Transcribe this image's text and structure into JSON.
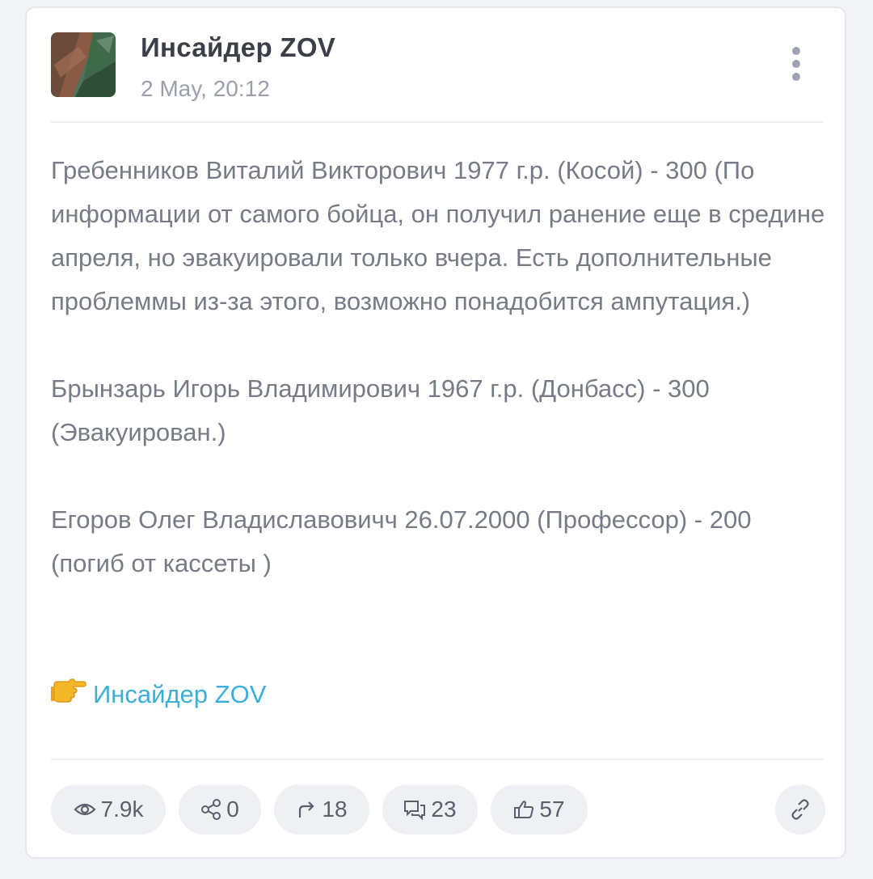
{
  "post": {
    "channel_name": "Инсайдер ZOV",
    "time": "2 May, 20:12",
    "paragraphs": [
      "Гребенников Виталий Викторович 1977 г.р. (Косой) - 300 (По информации от самого бойца, он получил ранение еще в средине апреля, но эвакуировали только вчера. Есть дополнительные проблеммы из-за этого, возможно понадобится ампутация.)",
      "Брынзарь Игорь Владимирович 1967 г.р. (Донбасс) - 300 (Эвакуирован.)",
      "Егоров Олег Владиславовичч 26.07.2000 (Профессор) - 200 (погиб от кассеты )"
    ],
    "signature": {
      "emoji": "pointing-right-hand-icon",
      "link_text": "Инсайдер ZOV"
    }
  },
  "stats": {
    "views": "7.9k",
    "shares": "0",
    "forwards": "18",
    "comments": "23",
    "likes": "57"
  },
  "icons": {
    "menu": "vertical-dots-icon",
    "views": "eye-icon",
    "shares": "share-icon",
    "forwards": "forward-arrow-icon",
    "comments": "comments-icon",
    "likes": "thumbs-up-icon",
    "link": "link-icon"
  },
  "colors": {
    "link": "#3bafda",
    "body_text": "#767b86",
    "title_text": "#3b3f47",
    "muted_text": "#9aa0ab",
    "pill_background": "#eef0f4",
    "page_background": "#f3f4f8"
  }
}
